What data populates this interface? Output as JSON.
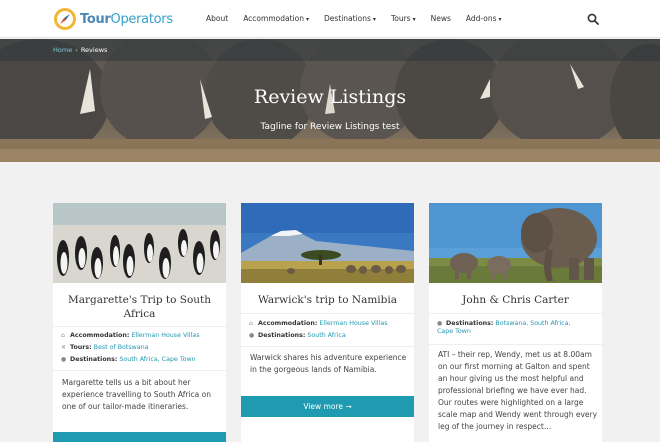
{
  "logo": {
    "part1": "Tour",
    "part2": "Operators"
  },
  "nav": [
    {
      "label": "About",
      "caret": ""
    },
    {
      "label": "Accommodation",
      "caret": "▾"
    },
    {
      "label": "Destinations",
      "caret": "▾"
    },
    {
      "label": "Tours",
      "caret": "▾"
    },
    {
      "label": "News",
      "caret": ""
    },
    {
      "label": "Add-ons",
      "caret": "▾"
    }
  ],
  "breadcrumb": {
    "home": "Home",
    "sep": "›",
    "current": "Reviews"
  },
  "hero": {
    "title": "Review Listings",
    "tagline": "Tagline for Review Listings test"
  },
  "cards": [
    {
      "title": "Margarette's Trip to South Africa",
      "accommodation_label": "Accommodation:",
      "accommodation": "Ellerman House Villas",
      "tours_label": "Tours:",
      "tours": "Best of Botswana",
      "destinations_label": "Destinations:",
      "destinations": "South Africa, Cape Town",
      "excerpt": "Margarette tells us a bit about her experience travelling to South Africa on one of our tailor-made itineraries."
    },
    {
      "title": "Warwick's trip to Namibia",
      "accommodation_label": "Accommodation:",
      "accommodation": "Ellerman House Villas",
      "destinations_label": "Destinations:",
      "destinations": "South Africa",
      "excerpt": "Warwick shares his adventure experience in the gorgeous lands of Namibia.",
      "button": "View more →"
    },
    {
      "title": "John & Chris Carter",
      "destinations_label": "Destinations:",
      "destinations": "Botswana, South Africa, Cape Town",
      "excerpt": "ATI – their rep, Wendy, met us at 8.00am on our first morning at Galton and spent an hour giving us the most helpful and professional briefing we have ever had. Our routes were highlighted on a large scale map and Wendy went through every leg of the journey in respect…"
    }
  ],
  "colors": {
    "accent": "#1e9bb1",
    "link": "#2597b1"
  },
  "icons": {
    "search": "search-icon",
    "logo": "compass-icon"
  }
}
